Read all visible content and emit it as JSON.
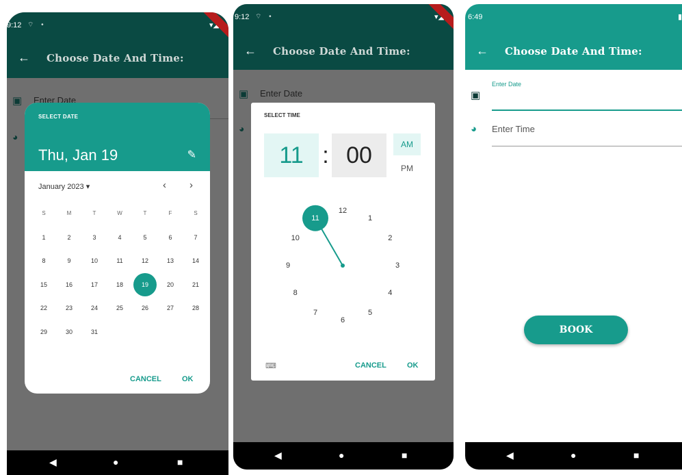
{
  "colors": {
    "primary": "#179b8c",
    "appbar_dark": "#0b4f47",
    "appbar_dim": "#0a4a43",
    "scrim": "#6f6f6f"
  },
  "screen1": {
    "time": "9:12",
    "title": "Choose Date And Time:",
    "enter_date": "Enter Date",
    "dialog": {
      "label": "SELECT DATE",
      "date": "Thu, Jan 19",
      "month": "January 2023 ▾",
      "weekdays": [
        "S",
        "M",
        "T",
        "W",
        "T",
        "F",
        "S"
      ],
      "weeks": [
        [
          "1",
          "2",
          "3",
          "4",
          "5",
          "6",
          "7"
        ],
        [
          "8",
          "9",
          "10",
          "11",
          "12",
          "13",
          "14"
        ],
        [
          "15",
          "16",
          "17",
          "18",
          "19",
          "20",
          "21"
        ],
        [
          "22",
          "23",
          "24",
          "25",
          "26",
          "27",
          "28"
        ],
        [
          "29",
          "30",
          "31",
          "",
          "",
          "",
          ""
        ]
      ],
      "selected_day": "19",
      "cancel": "CANCEL",
      "ok": "OK"
    }
  },
  "screen2": {
    "time": "9:12",
    "title": "Choose Date And Time:",
    "enter_date": "Enter Date",
    "dialog": {
      "label": "SELECT TIME",
      "hour": "11",
      "colon": ":",
      "minute": "00",
      "am": "AM",
      "pm": "PM",
      "clock_numbers": [
        "12",
        "1",
        "2",
        "3",
        "4",
        "5",
        "6",
        "7",
        "8",
        "9",
        "10",
        "11"
      ],
      "selected_hour": "11",
      "cancel": "CANCEL",
      "ok": "OK"
    }
  },
  "screen3": {
    "time": "6:49",
    "title": "Choose Date And Time:",
    "enter_date": "Enter Date",
    "enter_time": "Enter Time",
    "book": "BOOK"
  }
}
